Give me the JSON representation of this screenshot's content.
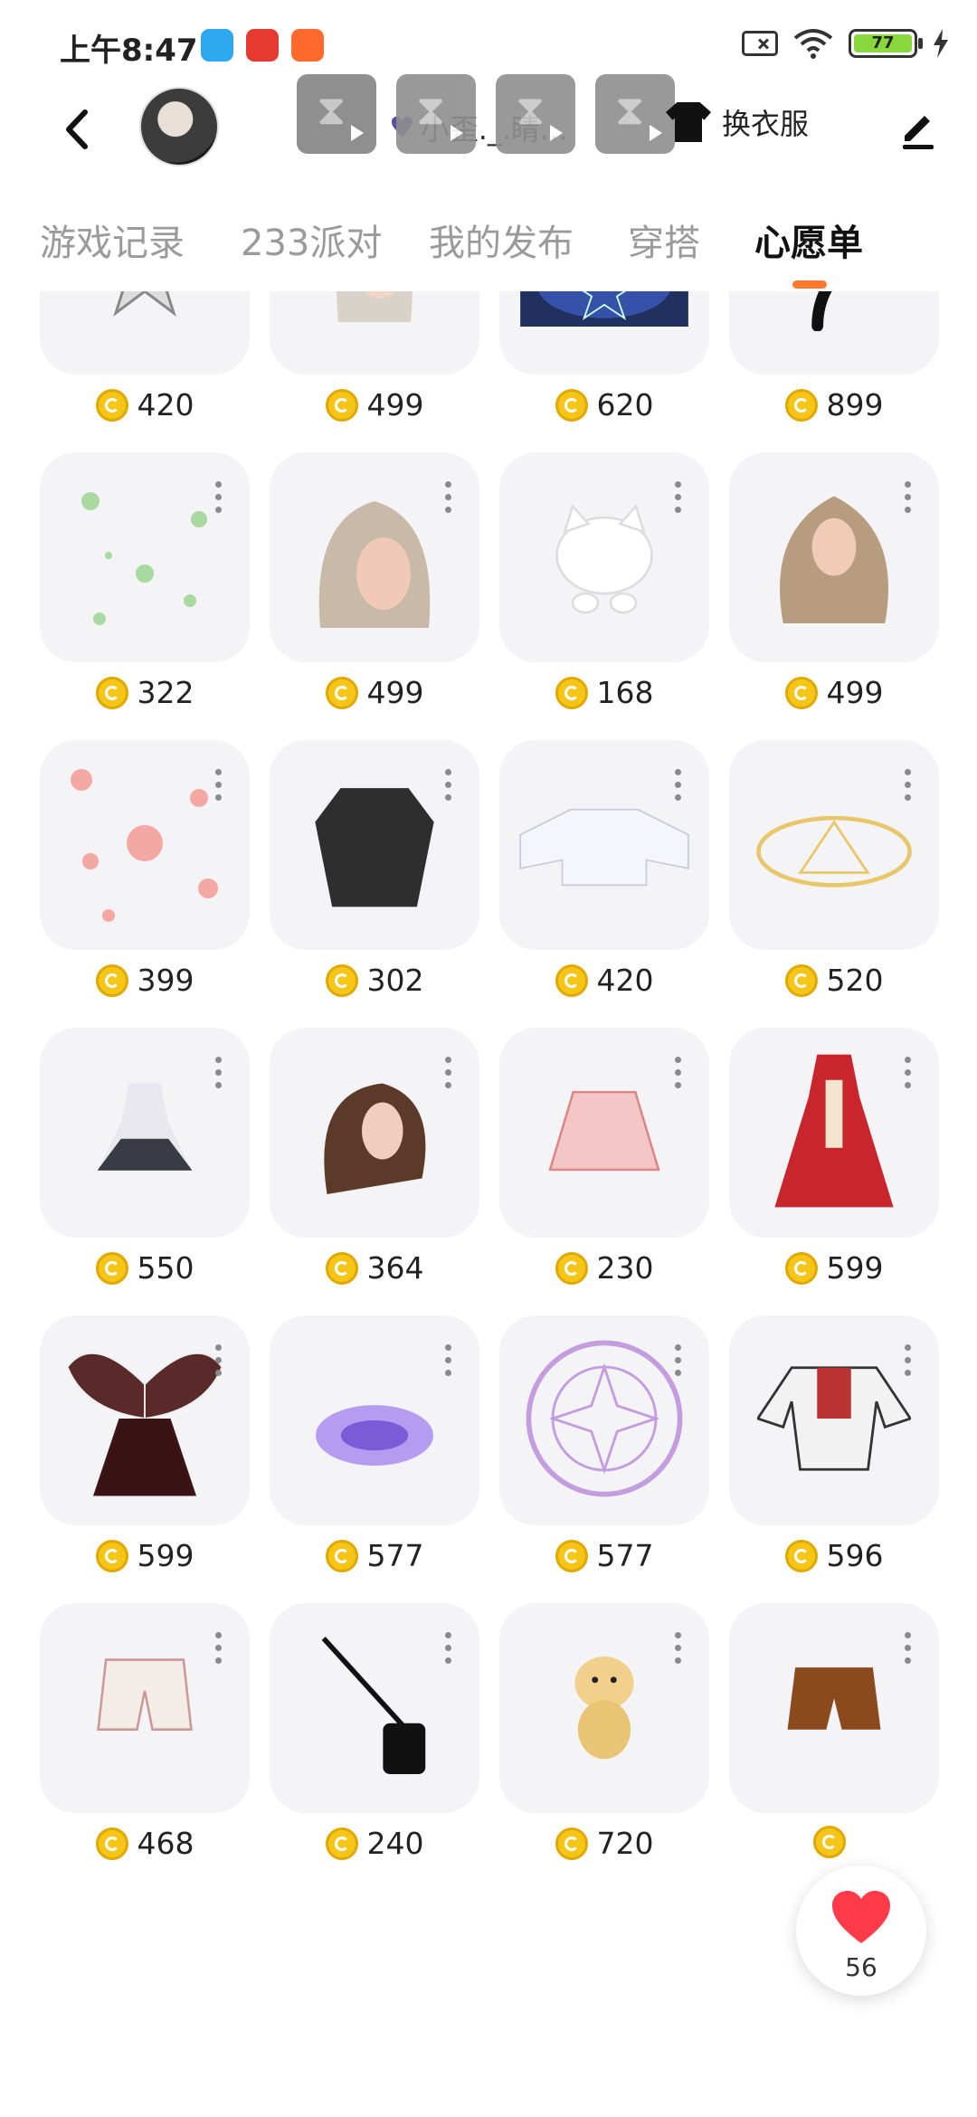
{
  "status_bar": {
    "time": "上午8:47",
    "battery": "77",
    "app_icons": [
      {
        "color": "#2fa8f2"
      },
      {
        "color": "#e63a30"
      },
      {
        "color": "#ff6a2c"
      }
    ]
  },
  "header": {
    "username": "小歪._.睛...",
    "outfit_button": "换衣服",
    "video_thumbs": 4
  },
  "tabs": [
    {
      "label": "游戏记录"
    },
    {
      "label": "233派对"
    },
    {
      "label": "我的发布"
    },
    {
      "label": "穿搭"
    },
    {
      "label": "心愿单",
      "active": true
    }
  ],
  "items": [
    {
      "price": "420",
      "icon": "star-effect"
    },
    {
      "price": "499",
      "icon": "long-hair"
    },
    {
      "price": "620",
      "icon": "starry-ring"
    },
    {
      "price": "899",
      "icon": "black-tail"
    },
    {
      "price": "322",
      "icon": "bubble-effect"
    },
    {
      "price": "499",
      "icon": "wavy-hair"
    },
    {
      "price": "168",
      "icon": "hello-kitty-hat"
    },
    {
      "price": "499",
      "icon": "twin-hair"
    },
    {
      "price": "399",
      "icon": "bear-effect"
    },
    {
      "price": "302",
      "icon": "black-coat"
    },
    {
      "price": "420",
      "icon": "white-crop-top"
    },
    {
      "price": "520",
      "icon": "magic-circle-gold"
    },
    {
      "price": "550",
      "icon": "white-dress"
    },
    {
      "price": "364",
      "icon": "brown-hair"
    },
    {
      "price": "230",
      "icon": "pink-skirt"
    },
    {
      "price": "599",
      "icon": "red-hanfu"
    },
    {
      "price": "599",
      "icon": "butterfly-dress"
    },
    {
      "price": "577",
      "icon": "purple-aura"
    },
    {
      "price": "577",
      "icon": "magic-circle-purple"
    },
    {
      "price": "596",
      "icon": "jacket"
    },
    {
      "price": "468",
      "icon": "shorts"
    },
    {
      "price": "240",
      "icon": "bag"
    },
    {
      "price": "720",
      "icon": "puppy"
    },
    {
      "price": "",
      "icon": "brown-shorts"
    }
  ],
  "like_button": {
    "count": "56"
  },
  "colors": {
    "accent": "#ff7a2f",
    "coin": "#f5c518",
    "like": "#ff3b4a"
  }
}
